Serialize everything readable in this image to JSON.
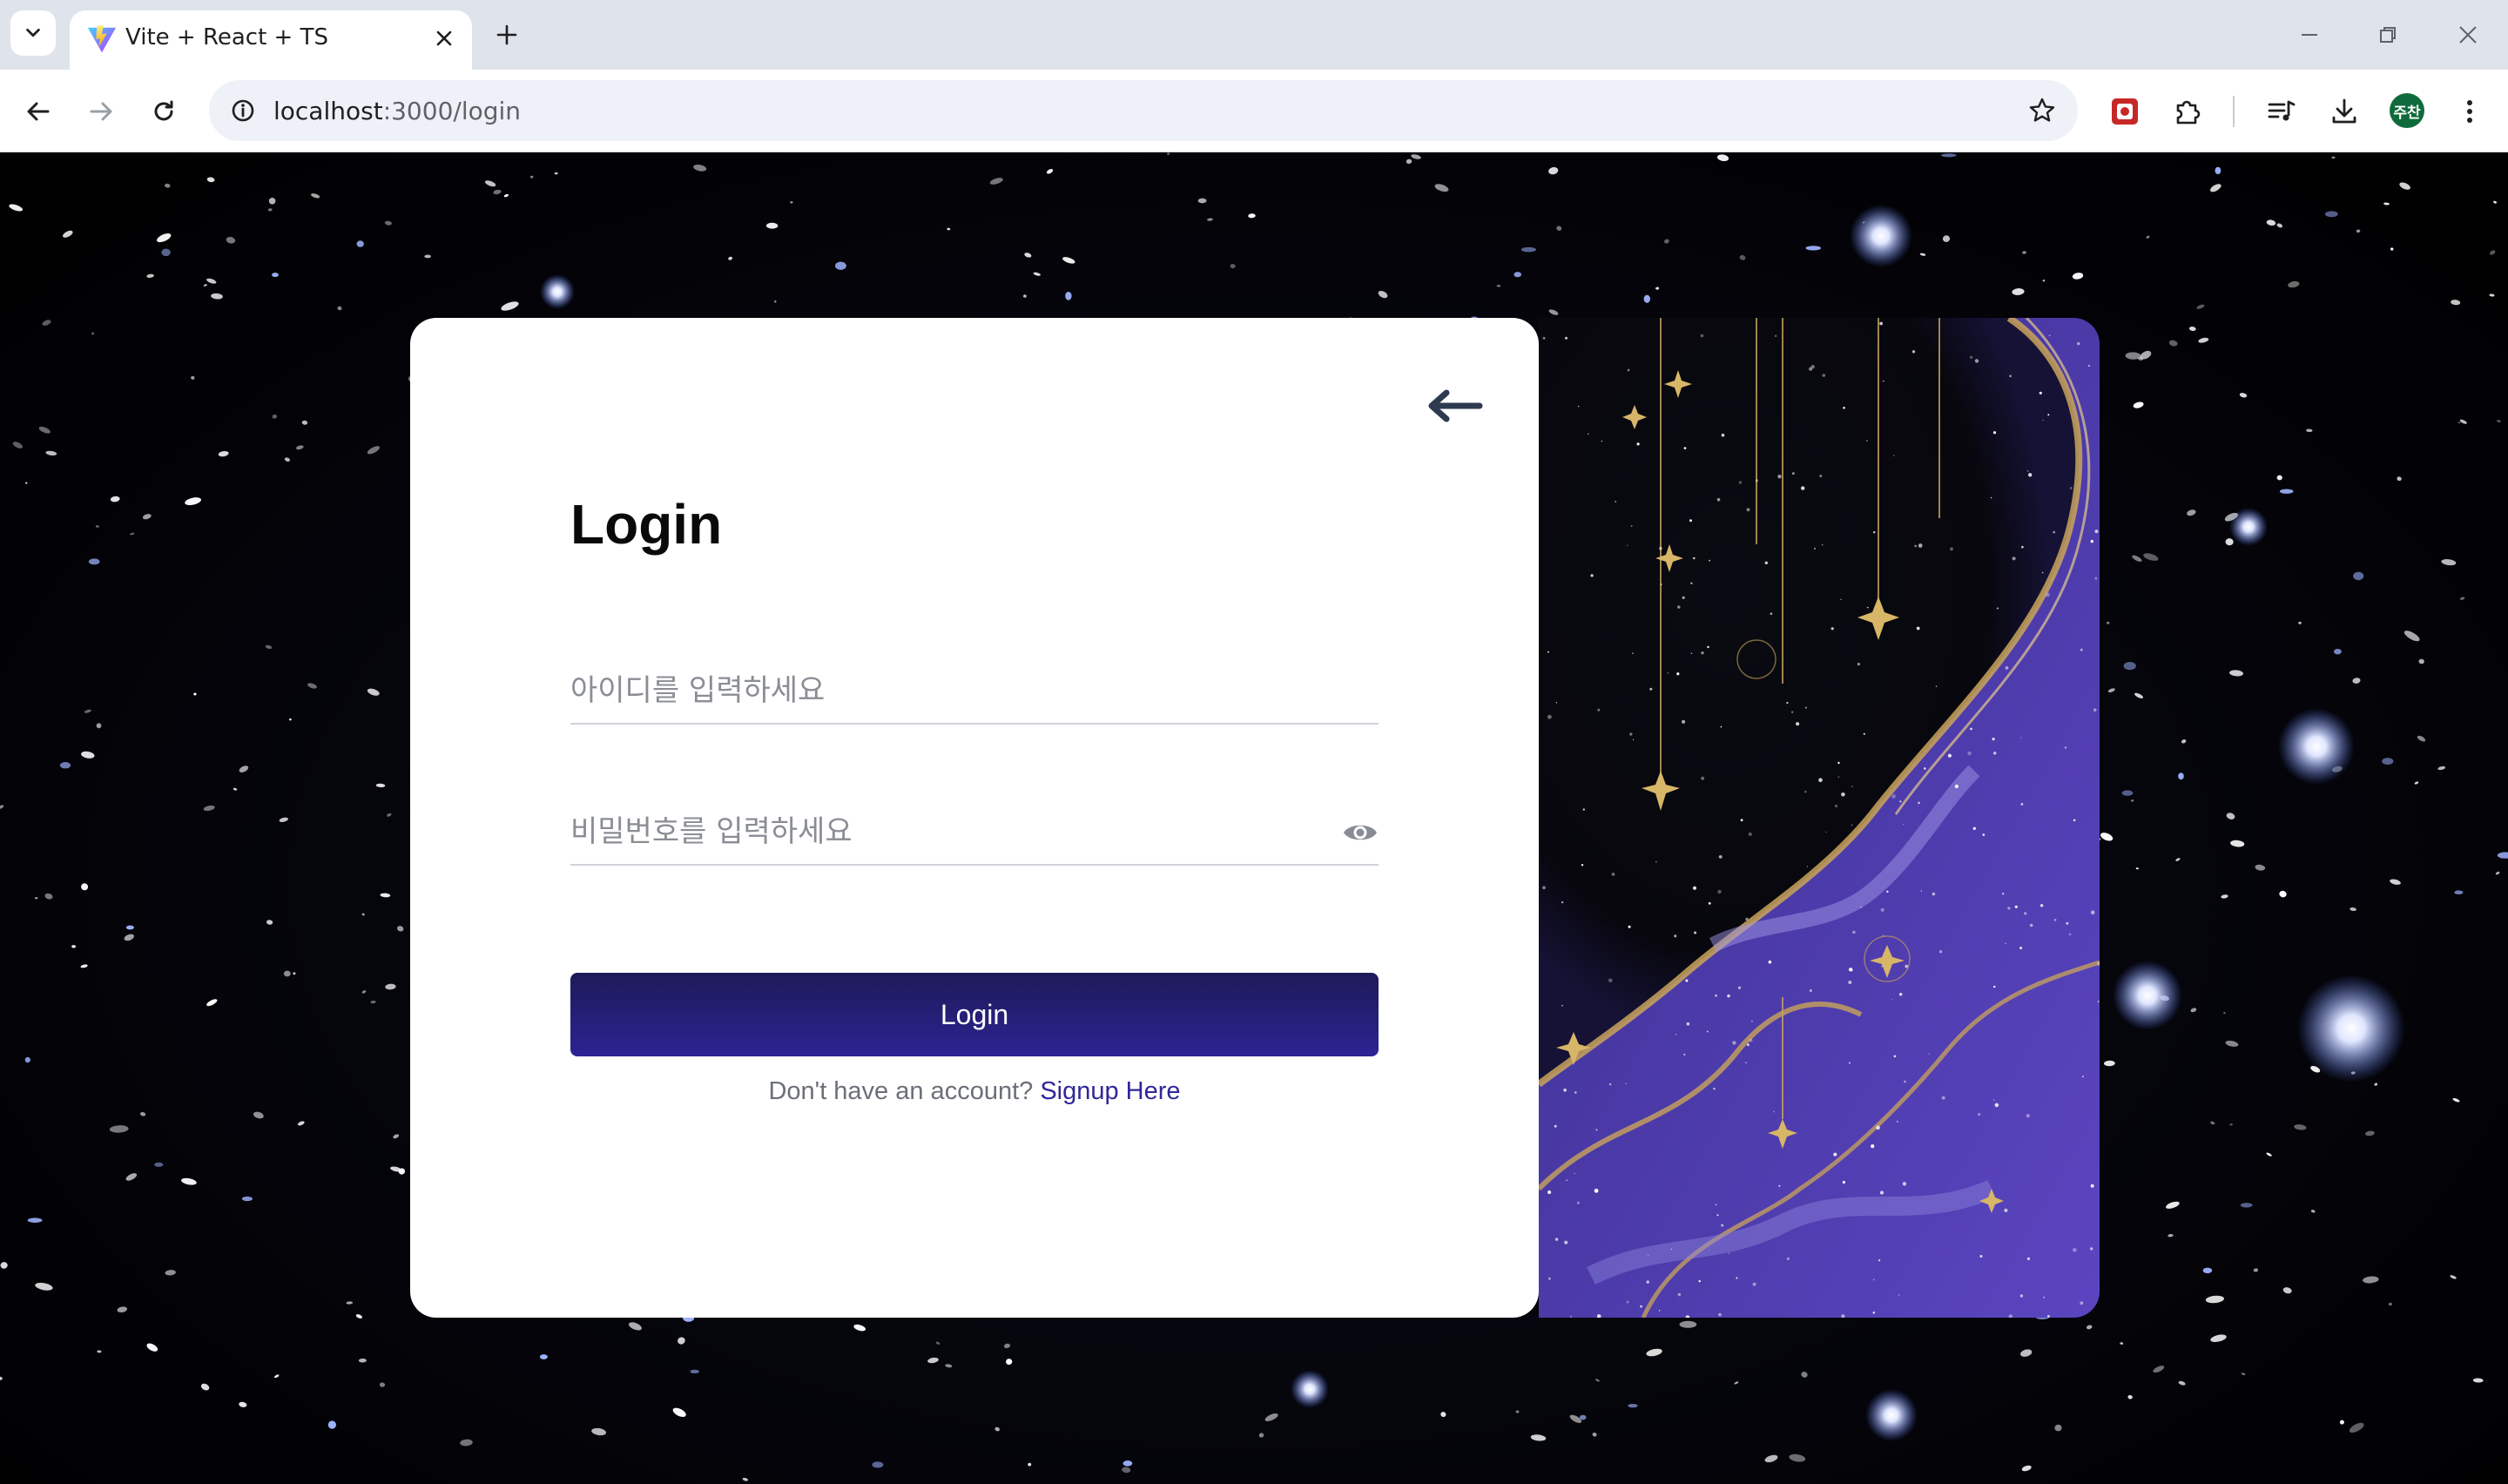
{
  "browser": {
    "tab_title": "Vite + React + TS",
    "url_host": "localhost",
    "url_path": ":3000/login",
    "profile_initials": "주찬"
  },
  "login": {
    "title": "Login",
    "id_placeholder": "아이디를 입력하세요",
    "password_placeholder": "비밀번호를 입력하세요",
    "submit_label": "Login",
    "signup_prompt": "Don't have an account?",
    "signup_link": "Signup Here"
  },
  "colors": {
    "button_top": "#1e1a58",
    "button_bottom": "#2c2494",
    "link": "#2f279a",
    "art_purple": "#4b3aa8",
    "art_gold": "#c9a45a"
  },
  "icons": [
    "tab-search-icon",
    "vite-favicon-icon",
    "close-icon",
    "plus-icon",
    "minimize-icon",
    "restore-icon",
    "window-close-icon",
    "back-arrow-icon",
    "forward-arrow-icon",
    "reload-icon",
    "site-info-icon",
    "star-icon",
    "extension-puzzle-icon",
    "media-control-icon",
    "download-icon",
    "more-vert-icon",
    "back-arrow-icon",
    "eye-icon"
  ]
}
